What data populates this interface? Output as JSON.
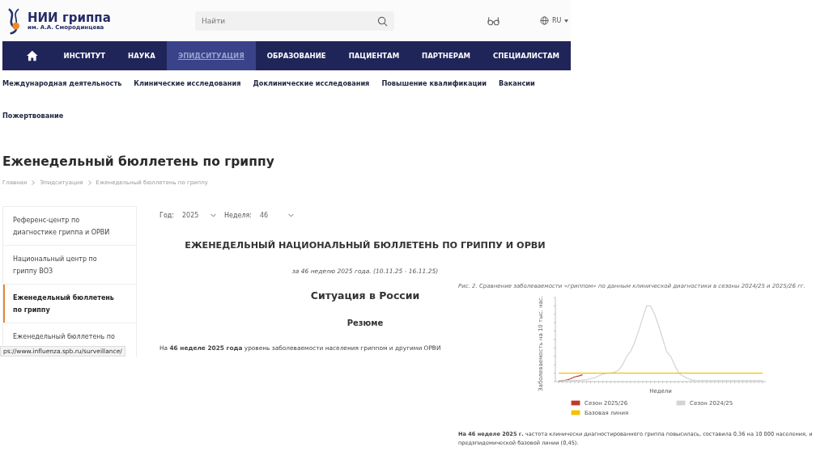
{
  "header": {
    "logo_title": "НИИ гриппа",
    "logo_subtitle": "им. А.А. Смородинцева",
    "search": {
      "placeholder": "Найти"
    },
    "language": "RU"
  },
  "main_nav": [
    {
      "label": "ИНСТИТУТ",
      "selected": false
    },
    {
      "label": "НАУКА",
      "selected": false
    },
    {
      "label": "ЭПИДСИТУАЦИЯ",
      "selected": true
    },
    {
      "label": "ОБРАЗОВАНИЕ",
      "selected": false
    },
    {
      "label": "ПАЦИЕНТАМ",
      "selected": false
    },
    {
      "label": "ПАРТНЕРАМ",
      "selected": false
    },
    {
      "label": "СПЕЦИАЛИСТАМ",
      "selected": false
    }
  ],
  "sub_nav": [
    "Международная деятельность",
    "Клинические исследования",
    "Доклинические исследования",
    "Повышение квалификации",
    "Вакансии",
    "Пожертвование"
  ],
  "page_title": "Еженедельный бюллетень по гриппу",
  "breadcrumbs": [
    "Главная",
    "Эпидситуация",
    "Еженедельный бюллетень по гриппу"
  ],
  "sidebar": [
    {
      "label": "Референс-центр по диагностике гриппа и ОРВИ",
      "selected": false
    },
    {
      "label": "Национальный центр по гриппу ВОЗ",
      "selected": false
    },
    {
      "label": "Еженедельный бюллетень по гриппу",
      "selected": true
    },
    {
      "label": "Еженедельный бюллетень по",
      "selected": false
    }
  ],
  "filters": [
    {
      "label": "Год:",
      "value": "2025"
    },
    {
      "label": "Неделя:",
      "value": "46"
    }
  ],
  "bulletin_title": "ЕЖЕНЕДЕЛЬНЫЙ НАЦИОНАЛЬНЫЙ БЮЛЛЕТЕНЬ ПО ГРИППУ И ОРВИ",
  "bulletin_period": "за 46 неделю 2025 года. (10.11.25 - 16.11.25)",
  "section_title": "Ситуация в России",
  "summary_title": "Резюме",
  "summary_text": "На **46 неделе 2025 года** уровень заболеваемости населения гриппом и другими ОРВИ",
  "status_url": "ps://www.influenza.spb.ru/surveillance/",
  "figure": {
    "caption": "Рис. 2. Сравнение заболеваемости «гриппом» по данным клинической диагностики в сезоны 2024/25 и 2025/26 гг.",
    "ylabel": "Заболеваемость на 10 тыс. нас.",
    "xlabel": "Недели",
    "legend": [
      {
        "label": "Сезон 2025/26",
        "color": "#c0392b"
      },
      {
        "label": "Сезон 2024/25",
        "color": "#d4d4d4"
      },
      {
        "label": "Базовая линия",
        "color": "#f2c200"
      }
    ],
    "text": "**На 46 неделе 2025 г.** частота клинически диагностированного гриппа повысилась, составила 0,36 на 10 000 населения, и",
    "text_2": "предэпидемической базовой линии (0,45)."
  }
}
